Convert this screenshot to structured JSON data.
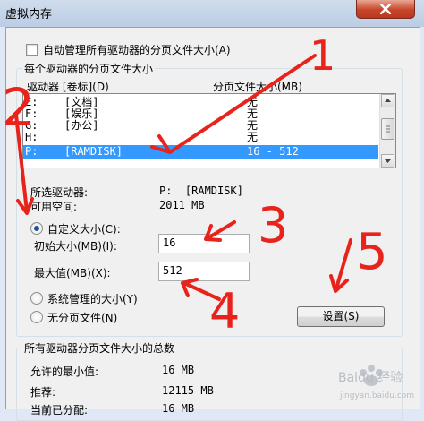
{
  "window": {
    "title": "虚拟内存"
  },
  "auto_manage": {
    "label": "自动管理所有驱动器的分页文件大小(A)",
    "checked": false
  },
  "per_drive": {
    "group_label": "每个驱动器的分页文件大小",
    "col_drive": "驱动器 [卷标](D)",
    "col_size": "分页文件大小(MB)",
    "rows": [
      {
        "drive": "E:",
        "label": "[文档]",
        "size": "无"
      },
      {
        "drive": "F:",
        "label": "[娱乐]",
        "size": "无"
      },
      {
        "drive": "G:",
        "label": "[办公]",
        "size": "无"
      },
      {
        "drive": "H:",
        "label": "",
        "size": "无"
      },
      {
        "drive": "P:",
        "label": "[RAMDISK]",
        "size": "16 - 512"
      }
    ],
    "selected_drive_label": "所选驱动器:",
    "selected_drive_value": "P:  [RAMDISK]",
    "free_space_label": "可用空间:",
    "free_space_value": "2011 MB",
    "custom_size_label": "自定义大小(C):",
    "initial_label": "初始大小(MB)(I):",
    "initial_value": "16",
    "max_label": "最大值(MB)(X):",
    "max_value": "512",
    "system_managed_label": "系统管理的大小(Y)",
    "no_paging_label": "无分页文件(N)",
    "set_button": "设置(S)"
  },
  "totals": {
    "group_label": "所有驱动器分页文件大小的总数",
    "min_label": "允许的最小值:",
    "min_value": "16 MB",
    "recommended_label": "推荐:",
    "recommended_value": "12115 MB",
    "current_label": "当前已分配:",
    "current_value": "16 MB"
  },
  "annotations": {
    "n1": "1",
    "n2": "2",
    "n3": "3",
    "n4": "4",
    "n5": "5",
    "color": "#e8231b"
  },
  "watermark": {
    "text": "Baidu 经验",
    "sub": "jingyan.baidu.com"
  }
}
